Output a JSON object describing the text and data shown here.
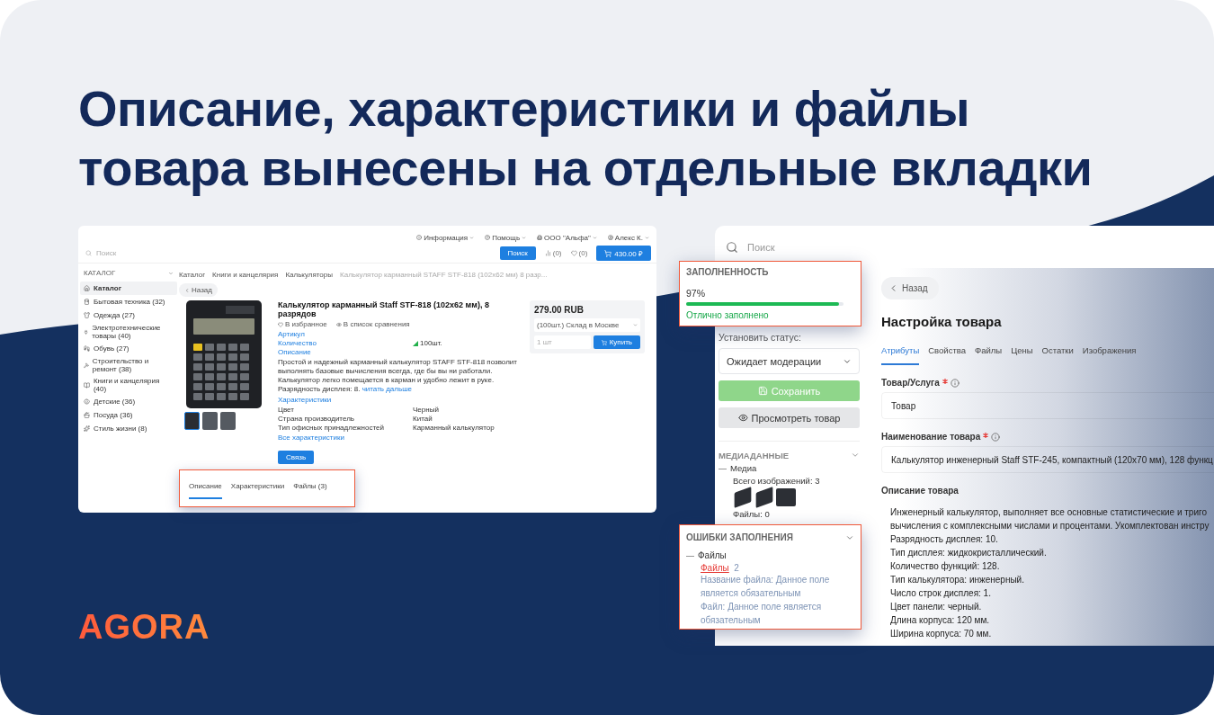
{
  "headline_lines": [
    "Описание, характеристики и файлы",
    "товара вынесены на отдельные вкладки"
  ],
  "logo": "AGORA",
  "shop": {
    "top_menu": [
      "Информация",
      "Помощь",
      "ООО \"Альфа\"",
      "Алекс К."
    ],
    "search": {
      "placeholder": "Поиск",
      "button": "Поиск"
    },
    "compare_count": "(0)",
    "favorites_count": "(0)",
    "cart_total": "430.00 ₽",
    "catalog_title": "КАТАЛОГ",
    "categories": [
      {
        "label": "Каталог",
        "kind": "home",
        "selected": true
      },
      {
        "label": "Бытовая техника (32)",
        "kind": "appliance",
        "selected": false
      },
      {
        "label": "Одежда (27)",
        "kind": "clothes",
        "selected": false
      },
      {
        "label": "Электротехнические товары (40)",
        "kind": "electric",
        "selected": false
      },
      {
        "label": "Обувь (27)",
        "kind": "shoes",
        "selected": false
      },
      {
        "label": "Строительство и ремонт (38)",
        "kind": "tools",
        "selected": false
      },
      {
        "label": "Книги и канцелярия (40)",
        "kind": "books",
        "selected": false
      },
      {
        "label": "Детские (36)",
        "kind": "kids",
        "selected": false
      },
      {
        "label": "Посуда (36)",
        "kind": "dishes",
        "selected": false
      },
      {
        "label": "Стиль жизни (8)",
        "kind": "life",
        "selected": false
      }
    ],
    "breadcrumbs": [
      "Каталог",
      "Книги и канцелярия",
      "Калькуляторы",
      "Калькулятор карманный STAFF STF-818 (102x62 мм) 8 разр..."
    ],
    "back": "Назад",
    "product": {
      "title": "Калькулятор карманный Staff STF-818 (102x62 мм), 8 разрядов",
      "favorite": "В избранное",
      "compare": "В список сравнения",
      "links": [
        "Артикул",
        "Количество",
        "Описание"
      ],
      "stock": "100шт.",
      "description": "Простой и надежный карманный калькулятор STAFF STF-818 позволит выполнять базовые вычисления всегда, где бы вы ни работали. Калькулятор легко помещается в карман и удобно лежит в руке. Разрядность дисплея: 8.",
      "more": "читать дальше",
      "specs_title": "Характеристики",
      "specs": [
        {
          "name": "Цвет",
          "value": "Черный"
        },
        {
          "name": "Страна производитель",
          "value": "Китай"
        },
        {
          "name": "Тип офисных принадлежностей",
          "value": "Карманный калькулятор"
        }
      ],
      "all_specs": "Все характеристики",
      "contact": "Связь"
    },
    "price": {
      "amount": "279.00 RUB",
      "warehouse": "(100шт.) Склад в Москве",
      "quantity": "1 шт",
      "buy": "Купить"
    },
    "tabs": [
      {
        "label": "Описание",
        "selected": true
      },
      {
        "label": "Характеристики",
        "selected": false
      },
      {
        "label": "Файлы (3)",
        "selected": false
      }
    ]
  },
  "admin": {
    "search": {
      "placeholder": "Поиск"
    },
    "completeness": {
      "title": "ЗАПОЛНЕННОСТЬ",
      "value": "97%",
      "level": 0.97,
      "note": "Отлично заполнено"
    },
    "status_label": "Установить статус:",
    "status": "Ожидает модерации",
    "save": "Сохранить",
    "preview": "Просмотреть товар",
    "media": {
      "title": "МЕДИАДАННЫЕ",
      "group": "Медиа",
      "images": "Всего изображений: 3",
      "files": "Файлы: 0"
    },
    "errors": {
      "title": "ОШИБКИ ЗАПОЛНЕНИЯ",
      "group": "Файлы",
      "link": "Файлы",
      "count": "2",
      "messages": [
        "Название файла: Данное поле является обязательным",
        "Файл: Данное поле является обязательным"
      ]
    },
    "back": "Назад",
    "title": "Настройка товара",
    "tabs": [
      {
        "label": "Атрибуты",
        "selected": true
      },
      {
        "label": "Свойства",
        "selected": false
      },
      {
        "label": "Файлы",
        "selected": false
      },
      {
        "label": "Цены",
        "selected": false
      },
      {
        "label": "Остатки",
        "selected": false
      },
      {
        "label": "Изображения",
        "selected": false
      }
    ],
    "fields": [
      {
        "label": "Товар/Услуга",
        "required": true,
        "value": "Товар"
      },
      {
        "label": "Наименование товара",
        "required": true,
        "value": "Калькулятор инженерный Staff STF-245, компактный (120х70 мм), 128 функц"
      }
    ],
    "description_label": "Описание товара",
    "description_lines": [
      "Инженерный калькулятор, выполняет все основные статистические и триго",
      "вычисления с комплексными числами и процентами. Укомплектован инстру",
      "Разрядность дисплея: 10.",
      "Тип дисплея: жидкокристаллический.",
      "Количество функций: 128.",
      "Тип калькулятора: инженерный.",
      "Число строк дисплея: 1.",
      "Цвет панели: черный.",
      "Длина корпуса: 120 мм.",
      "Ширина корпуса: 70 мм."
    ]
  }
}
